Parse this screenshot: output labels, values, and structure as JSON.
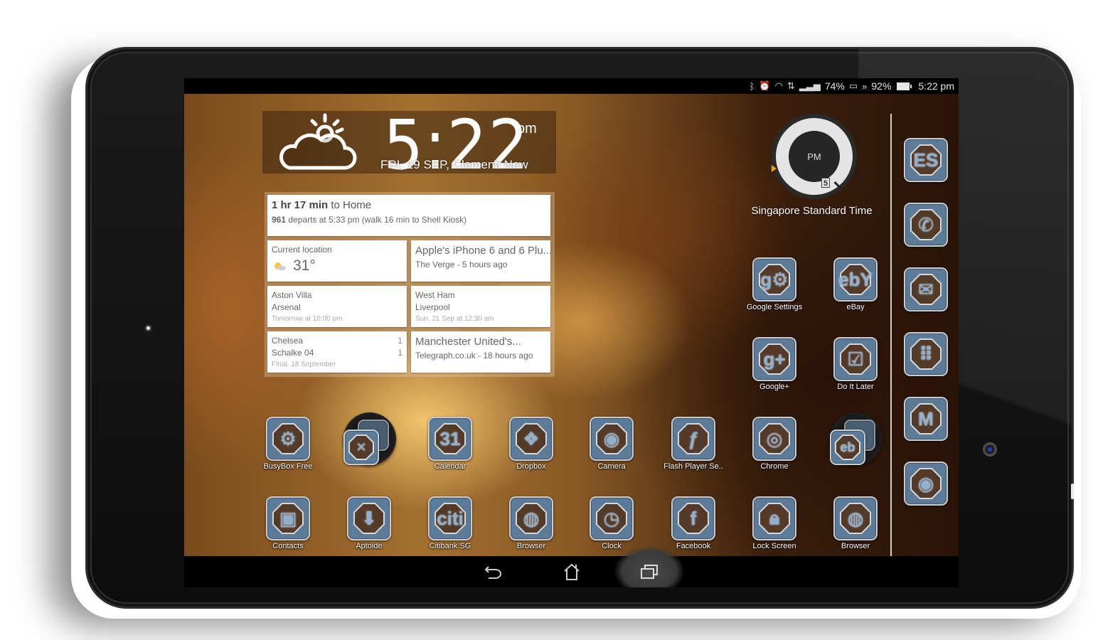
{
  "status_bar": {
    "icons": [
      "bluetooth-icon",
      "alarm-icon",
      "wifi-icon",
      "data-arrows-icon",
      "signal-icon"
    ],
    "signal_percent": "74%",
    "battery_percent": "92%",
    "time": "5:22 pm"
  },
  "clock_widget": {
    "weather_icon": "partly-cloudy-icon",
    "time": "5:22",
    "ampm": "pm",
    "date_location": "FRI, 19 SEP, Clementi New"
  },
  "google_now": {
    "commute": {
      "duration": "1 hr 17 min",
      "destination": "to Home",
      "bus": "961",
      "detail": "departs at 5:33 pm (walk 16 min to Shell Kiosk)"
    },
    "weather": {
      "label": "Current location",
      "temperature": "31°",
      "icon": "sun-cloud-icon"
    },
    "news": [
      {
        "headline": "Apple's iPhone 6 and 6 Plu...",
        "source": "The Verge - 5 hours ago"
      },
      {
        "headline": "Manchester United's...",
        "source": "Telegraph.co.uk - 18 hours ago"
      }
    ],
    "matches": [
      {
        "home": "Aston Villa",
        "away": "Arsenal",
        "home_score": "",
        "away_score": "",
        "when": "Tomorrow at 10:00 pm"
      },
      {
        "home": "West Ham",
        "away": "Liverpool",
        "home_score": "",
        "away_score": "",
        "when": "Sun, 21 Sep at 12:30 am"
      },
      {
        "home": "Chelsea",
        "away": "Schalke 04",
        "home_score": "1",
        "away_score": "1",
        "when": "Final, 18 September"
      }
    ]
  },
  "world_clock": {
    "center_label": "PM",
    "hour": "5",
    "timezone": "Singapore Standard Time"
  },
  "apps_right_grid": [
    {
      "label": "Google Settings",
      "glyph": "g⚙"
    },
    {
      "label": "eBay",
      "glyph": "ebY"
    },
    {
      "label": "Google+",
      "glyph": "g+"
    },
    {
      "label": "Do It Later",
      "glyph": "☑"
    }
  ],
  "apps_row1": [
    {
      "label": "BusyBox Free",
      "glyph": "⚙"
    },
    {
      "label": "",
      "glyph": "✕",
      "folder": true
    },
    {
      "label": "Calendar",
      "glyph": "31"
    },
    {
      "label": "Dropbox",
      "glyph": "❖"
    },
    {
      "label": "Camera",
      "glyph": "◉"
    },
    {
      "label": "Flash Player Se..",
      "glyph": "ƒ"
    },
    {
      "label": "Chrome",
      "glyph": "◎"
    },
    {
      "label": "",
      "glyph": "eb",
      "folder": true
    }
  ],
  "apps_row2": [
    {
      "label": "Contacts",
      "glyph": "▣"
    },
    {
      "label": "Aptoide",
      "glyph": "⬇"
    },
    {
      "label": "Citibank SG",
      "glyph": "citi"
    },
    {
      "label": "Browser",
      "glyph": "◍"
    },
    {
      "label": "Clock",
      "glyph": "◷"
    },
    {
      "label": "Facebook",
      "glyph": "f"
    },
    {
      "label": "Lock Screen",
      "glyph": "🔒︎"
    },
    {
      "label": "Browser",
      "glyph": "◍"
    }
  ],
  "dock": [
    {
      "name": "es-file-explorer",
      "glyph": "ES"
    },
    {
      "name": "phone",
      "glyph": "✆"
    },
    {
      "name": "messaging",
      "glyph": "✉"
    },
    {
      "name": "app-drawer",
      "glyph": "⠿"
    },
    {
      "name": "gmail",
      "glyph": "M"
    },
    {
      "name": "camera",
      "glyph": "◉"
    }
  ],
  "navbar": {
    "back": "back-icon",
    "home": "home-icon",
    "recents": "recent-apps-icon"
  }
}
